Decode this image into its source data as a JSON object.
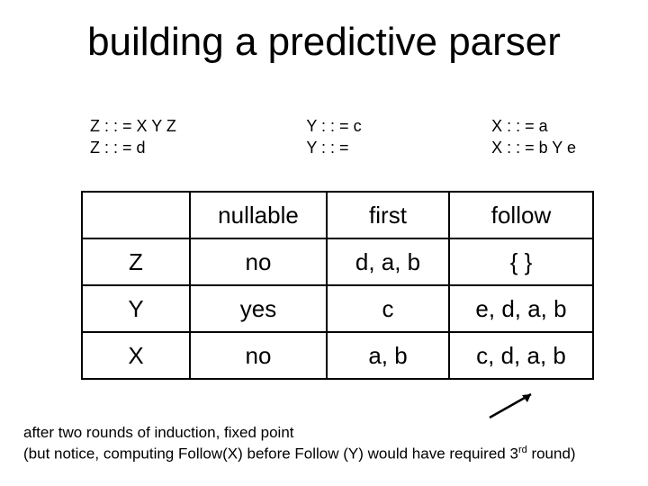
{
  "title": "building a predictive parser",
  "grammar": {
    "col1": {
      "line1": "Z : : = X Y Z",
      "line2": "Z : : = d"
    },
    "col2": {
      "line1": "Y : : = c",
      "line2": "Y : : ="
    },
    "col3": {
      "line1": "X : : = a",
      "line2": "X : : = b Y e"
    }
  },
  "table": {
    "headers": {
      "c0": "",
      "c1": "nullable",
      "c2": "first",
      "c3": "follow"
    },
    "rows": [
      {
        "sym": "Z",
        "nullable": "no",
        "first": "d, a, b",
        "follow": "{ }"
      },
      {
        "sym": "Y",
        "nullable": "yes",
        "first": "c",
        "follow": "e, d, a, b"
      },
      {
        "sym": "X",
        "nullable": "no",
        "first": "a, b",
        "follow": "c, d, a, b"
      }
    ]
  },
  "note": {
    "line1": "after two rounds of induction, fixed point",
    "line2a": "(but notice, computing Follow(X) before Follow (Y) would have required 3",
    "line2sup": "rd",
    "line2b": " round)"
  }
}
